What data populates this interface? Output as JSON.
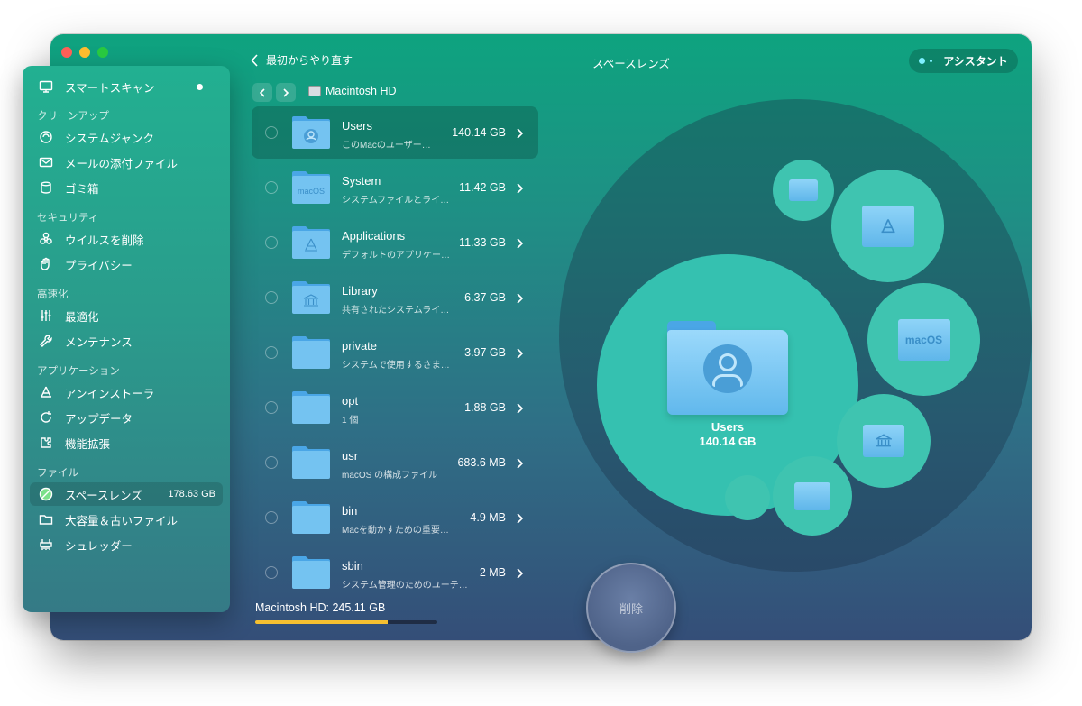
{
  "window": {
    "title": "スペースレンズ"
  },
  "header": {
    "back_label": "最初からやり直す",
    "assistant_label": "アシスタント"
  },
  "breadcrumb": {
    "disk_name": "Macintosh HD"
  },
  "sidebar": {
    "smart_scan": "スマートスキャン",
    "sections": {
      "cleanup": "クリーンアップ",
      "security": "セキュリティ",
      "speed": "高速化",
      "applications": "アプリケーション",
      "files": "ファイル"
    },
    "items": {
      "system_junk": "システムジャンク",
      "mail_attachments": "メールの添付ファイル",
      "trash": "ゴミ箱",
      "malware": "ウイルスを削除",
      "privacy": "プライバシー",
      "optimization": "最適化",
      "maintenance": "メンテナンス",
      "uninstaller": "アンインストーラ",
      "updater": "アップデータ",
      "extensions": "機能拡張",
      "space_lens": "スペースレンズ",
      "space_lens_size": "178.63 GB",
      "large_old_files": "大容量＆古いファイル",
      "shredder": "シュレッダー"
    }
  },
  "folders": [
    {
      "name": "Users",
      "desc": "このMacのユーザー…",
      "size": "140.14 GB",
      "icon": "user"
    },
    {
      "name": "System",
      "desc": "システムファイルとライ…",
      "size": "11.42 GB",
      "icon": "macos"
    },
    {
      "name": "Applications",
      "desc": "デフォルトのアプリケー…",
      "size": "11.33 GB",
      "icon": "apps"
    },
    {
      "name": "Library",
      "desc": "共有されたシステムライ…",
      "size": "6.37 GB",
      "icon": "library"
    },
    {
      "name": "private",
      "desc": "システムで使用するさま…",
      "size": "3.97 GB",
      "icon": "plain"
    },
    {
      "name": "opt",
      "desc": "1 個",
      "size": "1.88 GB",
      "icon": "plain"
    },
    {
      "name": "usr",
      "desc": "macOS の構成ファイル",
      "size": "683.6 MB",
      "icon": "plain"
    },
    {
      "name": "bin",
      "desc": "Macを動かすための重要…",
      "size": "4.9 MB",
      "icon": "plain"
    },
    {
      "name": "sbin",
      "desc": "システム管理のためのユーテ…",
      "size": "2 MB",
      "icon": "plain"
    }
  ],
  "disk_summary": {
    "label": "Macintosh HD: 245.11 GB",
    "used_fraction": 0.73
  },
  "delete_label": "削除",
  "viz": {
    "center_name": "Users",
    "center_size": "140.14 GB",
    "macos_badge": "macOS"
  },
  "colors": {
    "accent": "#0ea37f",
    "disk_fill": "#f6c030",
    "folder": "#6cc0f0"
  }
}
